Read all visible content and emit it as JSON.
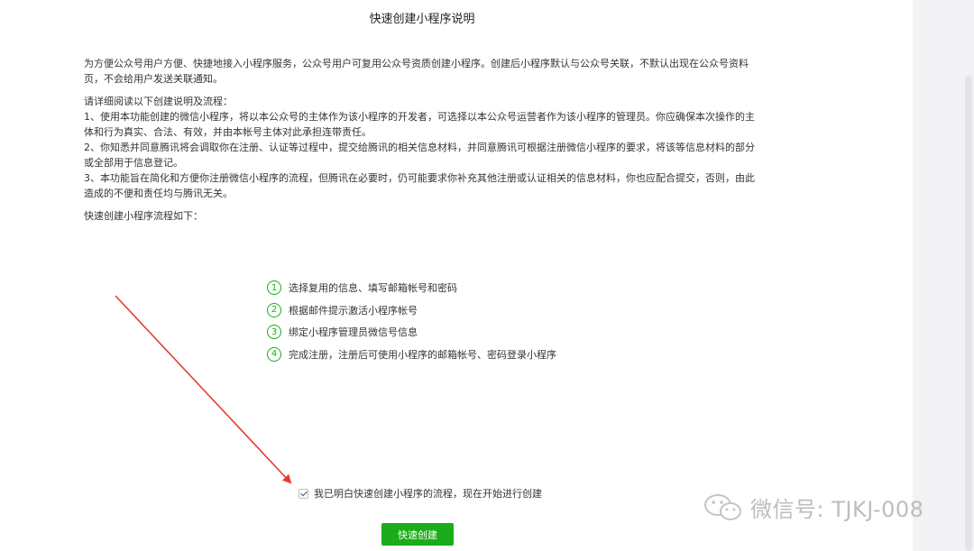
{
  "page": {
    "title": "快速创建小程序说明",
    "intro": "为方便公众号用户方便、快捷地接入小程序服务，公众号用户可复用公众号资质创建小程序。创建后小程序默认与公众号关联，不默认出现在公众号资料页，不会给用户发送关联通知。",
    "guide_lines": [
      "请详细阅读以下创建说明及流程：",
      "1、使用本功能创建的微信小程序，将以本公众号的主体作为该小程序的开发者，可选择以本公众号运营者作为该小程序的管理员。你应确保本次操作的主体和行为真实、合法、有效，并由本帐号主体对此承担连带责任。",
      "2、你知悉并同意腾讯将会调取你在注册、认证等过程中，提交给腾讯的相关信息材料，并同意腾讯可根据注册微信小程序的要求，将该等信息材料的部分或全部用于信息登记。",
      "3、本功能旨在简化和方便你注册微信小程序的流程，但腾讯在必要时，仍可能要求你补充其他注册或认证相关的信息材料，你也应配合提交，否则，由此造成的不便和责任均与腾讯无关。"
    ],
    "flow_title": "快速创建小程序流程如下：",
    "steps": [
      {
        "num": "1",
        "text": "选择复用的信息、填写邮箱帐号和密码"
      },
      {
        "num": "2",
        "text": "根据邮件提示激活小程序帐号"
      },
      {
        "num": "3",
        "text": "绑定小程序管理员微信号信息"
      },
      {
        "num": "4",
        "text": "完成注册，注册后可使用小程序的邮箱帐号、密码登录小程序"
      }
    ],
    "agree_text": "我已明白快速创建小程序的流程，现在开始进行创建",
    "agree_checked": true,
    "create_button": "快速创建"
  },
  "watermark": {
    "text": "微信号: TJKJ-008",
    "icon": "wechat-icon"
  },
  "colors": {
    "accent": "#1aad19",
    "arrow": "#e53935",
    "text": "#353535"
  }
}
